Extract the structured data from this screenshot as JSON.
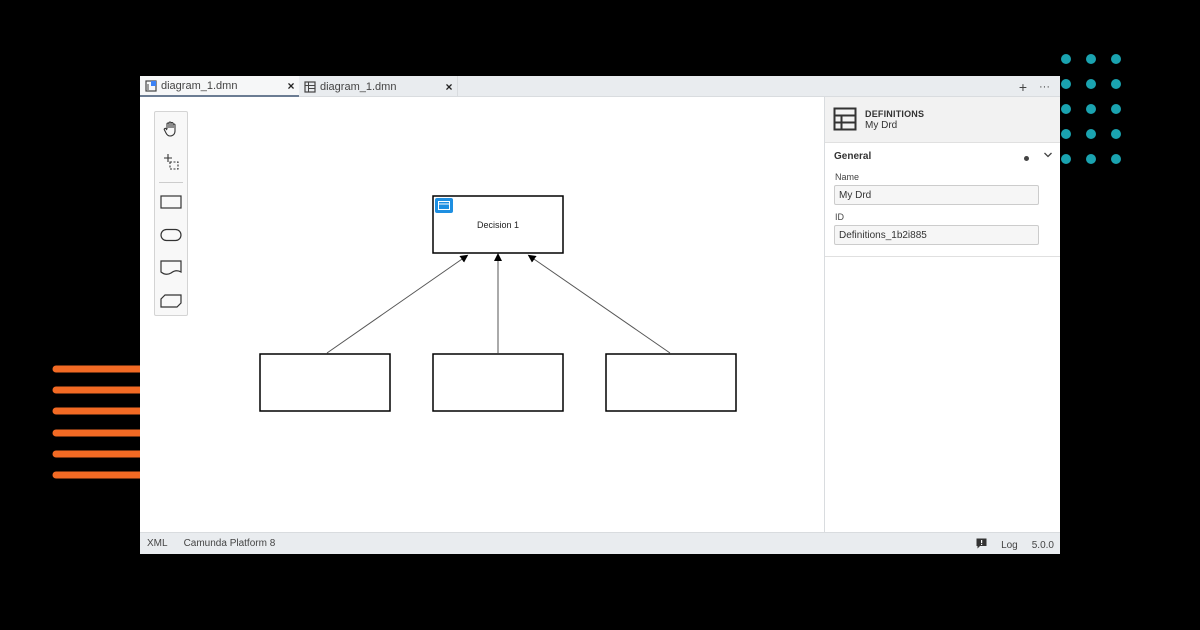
{
  "tabs": [
    {
      "label": "diagram_1.dmn",
      "close": "×",
      "icon": "drd-icon",
      "active": true
    },
    {
      "label": "diagram_1.dmn",
      "close": "×",
      "icon": "decision-table-icon",
      "active": false
    }
  ],
  "tab_actions": {
    "add": "+",
    "more": "···"
  },
  "palette": {
    "tools": [
      "hand-tool-icon",
      "lasso-tool-icon",
      "decision-icon",
      "input-data-icon",
      "knowledge-source-icon",
      "business-knowledge-model-icon"
    ]
  },
  "diagram": {
    "decision": {
      "label": "Decision 1",
      "icon": "decision-table-icon"
    },
    "inputs": [
      "",
      "",
      ""
    ]
  },
  "properties": {
    "type": "DEFINITIONS",
    "name": "My Drd",
    "group_title": "General",
    "name_label": "Name",
    "name_value": "My Drd",
    "id_label": "ID",
    "id_value": "Definitions_1b2i885"
  },
  "status_bar": {
    "xml": "XML",
    "platform": "Camunda Platform 8",
    "log": "Log",
    "version": "5.0.0"
  },
  "colors": {
    "accent_dots": "#1aa3b0",
    "accent_lines": "#f26a24",
    "decision_icon": "#1e8fe1"
  }
}
